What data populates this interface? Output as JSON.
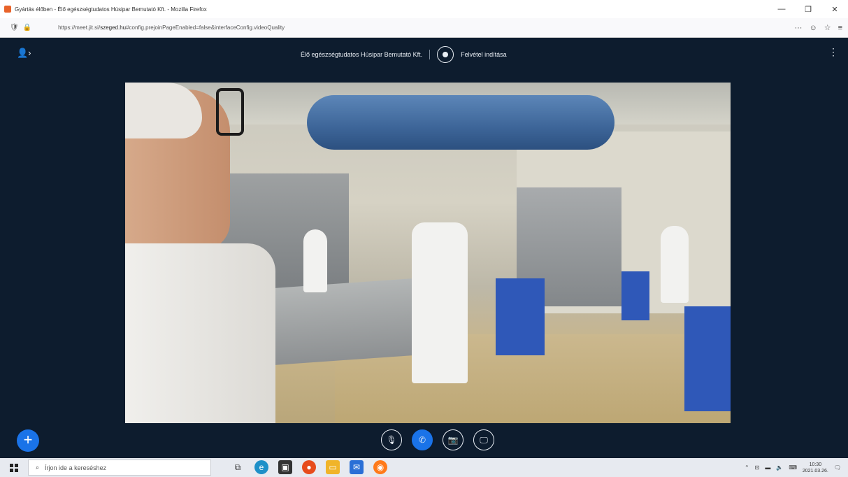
{
  "window": {
    "title": "Gyártás élőben - Élő egészségtudatos Húsipar Bemutató Kft. - Mozilla Firefox",
    "controls": [
      "—",
      "❐",
      "✕"
    ]
  },
  "urlbar": {
    "url_prefix": "https://meet.jit.si/",
    "url_domain": "szeged.hu",
    "url_rest": "#config.prejoinPageEnabled=false&interfaceConfig.videoQuality",
    "right_icons": [
      "···",
      "☺",
      "☆",
      "≡"
    ]
  },
  "meeting": {
    "title": "Élő egészségtudatos Húsipar Bemutató Kft.",
    "record_label": "Felvétel indítása"
  },
  "controls": {
    "add": "+",
    "mic": "🎙",
    "hangup": "✆",
    "camera": "📷",
    "share": "🖵"
  },
  "taskbar": {
    "search_placeholder": "Írjon ide a kereséshez",
    "clock_time": "10:30",
    "clock_date": "2021.03.26."
  },
  "colors": {
    "background": "#0d1c2e",
    "accent": "#1a73e8"
  }
}
